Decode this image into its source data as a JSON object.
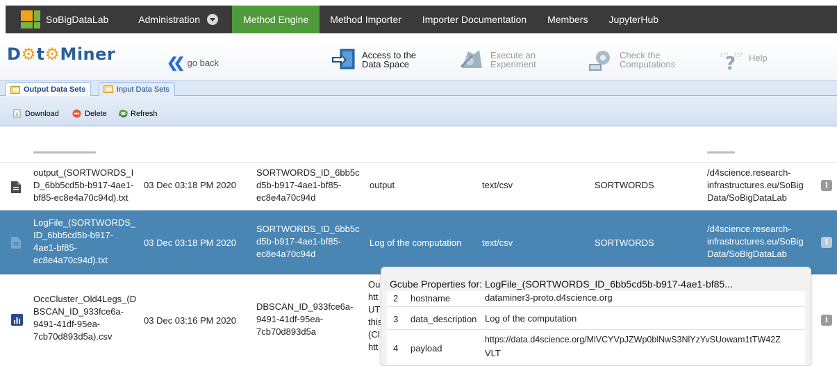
{
  "nav": {
    "brand": "SoBigDataLab",
    "items": [
      {
        "label": "Administration"
      },
      {
        "label": "Method Engine"
      },
      {
        "label": "Method Importer"
      },
      {
        "label": "Importer Documentation"
      },
      {
        "label": "Members"
      },
      {
        "label": "JupyterHub"
      }
    ]
  },
  "header": {
    "logo_parts": [
      "D",
      "t",
      "Miner"
    ],
    "go_back": "go back",
    "access": {
      "line1": "Access to the",
      "line2": "Data Space"
    },
    "execute": {
      "line1": "Execute an",
      "line2": "Experiment"
    },
    "check": {
      "line1": "Check the",
      "line2": "Computations"
    },
    "help": "Help"
  },
  "tabs": {
    "output": "Output Data Sets",
    "input": "Input Data Sets"
  },
  "toolbar": {
    "download": "Download",
    "delete": "Delete",
    "refresh": "Refresh"
  },
  "rows": [
    {
      "icon": "document-icon",
      "name": [
        "output_(SORTWORDS_I",
        "D_6bb5cd5b-b917-4ae1-",
        "bf85-ec8e4a70c94d).txt"
      ],
      "date": "03 Dec 03:18 PM 2020",
      "id": [
        "SORTWORDS_ID_6bb5c",
        "d5b-b917-4ae1-bf85-",
        "ec8e4a70c94d"
      ],
      "description": "output",
      "mime": "text/csv",
      "operator": "SORTWORDS",
      "path": [
        "/d4science.research-",
        "infrastructures.eu/SoBig",
        "Data/SoBigDataLab"
      ]
    },
    {
      "icon": "document-icon",
      "name": [
        "LogFile_(SORTWORDS_",
        "ID_6bb5cd5b-b917-",
        "4ae1-bf85-",
        "ec8e4a70c94d).txt"
      ],
      "date": "03 Dec 03:18 PM 2020",
      "id": [
        "SORTWORDS_ID_6bb5c",
        "d5b-b917-4ae1-bf85-",
        "ec8e4a70c94d"
      ],
      "description": "Log of the computation",
      "mime": "text/csv",
      "operator": "SORTWORDS",
      "path": [
        "/d4science.research-",
        "infrastructures.eu/SoBig",
        "Data/SoBigDataLab"
      ]
    },
    {
      "icon": "bar-chart-icon",
      "name": [
        "OccCluster_Old4Legs_(D",
        "BSCAN_ID_933fce6a-",
        "9491-41df-95ea-",
        "7cb70d893d5a).csv"
      ],
      "date": "03 Dec 03:16 PM 2020",
      "id": [
        "DBSCAN_ID_933fce6a-",
        "9491-41df-95ea-",
        "7cb70d893d5a"
      ],
      "description_fragments": [
        "Ou",
        "htt",
        "UT",
        "this",
        "(Cl",
        "htt"
      ]
    }
  ],
  "tooltip": {
    "title": "Gcube Properties for: LogFile_(SORTWORDS_ID_6bb5cd5b-b917-4ae1-bf85...",
    "rows": [
      {
        "n": "2",
        "key": "hostname",
        "value": [
          "dataminer3-proto.d4science.org"
        ]
      },
      {
        "n": "3",
        "key": "data_description",
        "value": [
          "Log of the computation"
        ]
      },
      {
        "n": "4",
        "key": "payload",
        "value": [
          "https://data.d4science.org/MlVCYVpJZWp0blNwS3NlYzYvSUowam1tTW42Z",
          "VLT"
        ]
      }
    ]
  }
}
